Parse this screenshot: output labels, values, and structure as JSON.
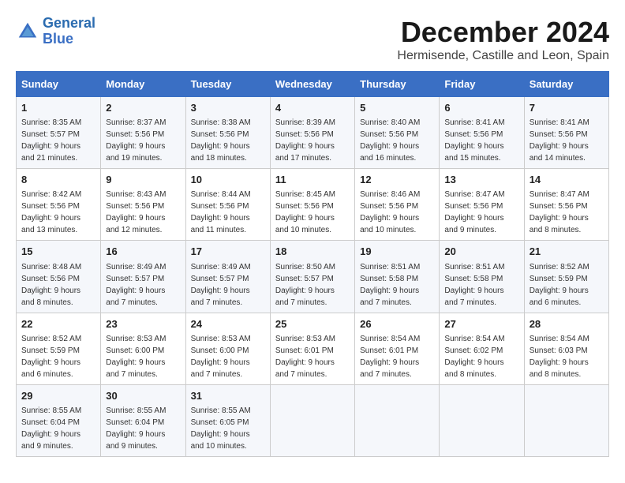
{
  "logo": {
    "line1": "General",
    "line2": "Blue"
  },
  "title": "December 2024",
  "subtitle": "Hermisende, Castille and Leon, Spain",
  "days_of_week": [
    "Sunday",
    "Monday",
    "Tuesday",
    "Wednesday",
    "Thursday",
    "Friday",
    "Saturday"
  ],
  "weeks": [
    [
      {
        "day": "1",
        "info": "Sunrise: 8:35 AM\nSunset: 5:57 PM\nDaylight: 9 hours and 21 minutes."
      },
      {
        "day": "2",
        "info": "Sunrise: 8:37 AM\nSunset: 5:56 PM\nDaylight: 9 hours and 19 minutes."
      },
      {
        "day": "3",
        "info": "Sunrise: 8:38 AM\nSunset: 5:56 PM\nDaylight: 9 hours and 18 minutes."
      },
      {
        "day": "4",
        "info": "Sunrise: 8:39 AM\nSunset: 5:56 PM\nDaylight: 9 hours and 17 minutes."
      },
      {
        "day": "5",
        "info": "Sunrise: 8:40 AM\nSunset: 5:56 PM\nDaylight: 9 hours and 16 minutes."
      },
      {
        "day": "6",
        "info": "Sunrise: 8:41 AM\nSunset: 5:56 PM\nDaylight: 9 hours and 15 minutes."
      },
      {
        "day": "7",
        "info": "Sunrise: 8:41 AM\nSunset: 5:56 PM\nDaylight: 9 hours and 14 minutes."
      }
    ],
    [
      {
        "day": "8",
        "info": "Sunrise: 8:42 AM\nSunset: 5:56 PM\nDaylight: 9 hours and 13 minutes."
      },
      {
        "day": "9",
        "info": "Sunrise: 8:43 AM\nSunset: 5:56 PM\nDaylight: 9 hours and 12 minutes."
      },
      {
        "day": "10",
        "info": "Sunrise: 8:44 AM\nSunset: 5:56 PM\nDaylight: 9 hours and 11 minutes."
      },
      {
        "day": "11",
        "info": "Sunrise: 8:45 AM\nSunset: 5:56 PM\nDaylight: 9 hours and 10 minutes."
      },
      {
        "day": "12",
        "info": "Sunrise: 8:46 AM\nSunset: 5:56 PM\nDaylight: 9 hours and 10 minutes."
      },
      {
        "day": "13",
        "info": "Sunrise: 8:47 AM\nSunset: 5:56 PM\nDaylight: 9 hours and 9 minutes."
      },
      {
        "day": "14",
        "info": "Sunrise: 8:47 AM\nSunset: 5:56 PM\nDaylight: 9 hours and 8 minutes."
      }
    ],
    [
      {
        "day": "15",
        "info": "Sunrise: 8:48 AM\nSunset: 5:56 PM\nDaylight: 9 hours and 8 minutes."
      },
      {
        "day": "16",
        "info": "Sunrise: 8:49 AM\nSunset: 5:57 PM\nDaylight: 9 hours and 7 minutes."
      },
      {
        "day": "17",
        "info": "Sunrise: 8:49 AM\nSunset: 5:57 PM\nDaylight: 9 hours and 7 minutes."
      },
      {
        "day": "18",
        "info": "Sunrise: 8:50 AM\nSunset: 5:57 PM\nDaylight: 9 hours and 7 minutes."
      },
      {
        "day": "19",
        "info": "Sunrise: 8:51 AM\nSunset: 5:58 PM\nDaylight: 9 hours and 7 minutes."
      },
      {
        "day": "20",
        "info": "Sunrise: 8:51 AM\nSunset: 5:58 PM\nDaylight: 9 hours and 7 minutes."
      },
      {
        "day": "21",
        "info": "Sunrise: 8:52 AM\nSunset: 5:59 PM\nDaylight: 9 hours and 6 minutes."
      }
    ],
    [
      {
        "day": "22",
        "info": "Sunrise: 8:52 AM\nSunset: 5:59 PM\nDaylight: 9 hours and 6 minutes."
      },
      {
        "day": "23",
        "info": "Sunrise: 8:53 AM\nSunset: 6:00 PM\nDaylight: 9 hours and 7 minutes."
      },
      {
        "day": "24",
        "info": "Sunrise: 8:53 AM\nSunset: 6:00 PM\nDaylight: 9 hours and 7 minutes."
      },
      {
        "day": "25",
        "info": "Sunrise: 8:53 AM\nSunset: 6:01 PM\nDaylight: 9 hours and 7 minutes."
      },
      {
        "day": "26",
        "info": "Sunrise: 8:54 AM\nSunset: 6:01 PM\nDaylight: 9 hours and 7 minutes."
      },
      {
        "day": "27",
        "info": "Sunrise: 8:54 AM\nSunset: 6:02 PM\nDaylight: 9 hours and 8 minutes."
      },
      {
        "day": "28",
        "info": "Sunrise: 8:54 AM\nSunset: 6:03 PM\nDaylight: 9 hours and 8 minutes."
      }
    ],
    [
      {
        "day": "29",
        "info": "Sunrise: 8:55 AM\nSunset: 6:04 PM\nDaylight: 9 hours and 9 minutes."
      },
      {
        "day": "30",
        "info": "Sunrise: 8:55 AM\nSunset: 6:04 PM\nDaylight: 9 hours and 9 minutes."
      },
      {
        "day": "31",
        "info": "Sunrise: 8:55 AM\nSunset: 6:05 PM\nDaylight: 9 hours and 10 minutes."
      },
      null,
      null,
      null,
      null
    ]
  ]
}
